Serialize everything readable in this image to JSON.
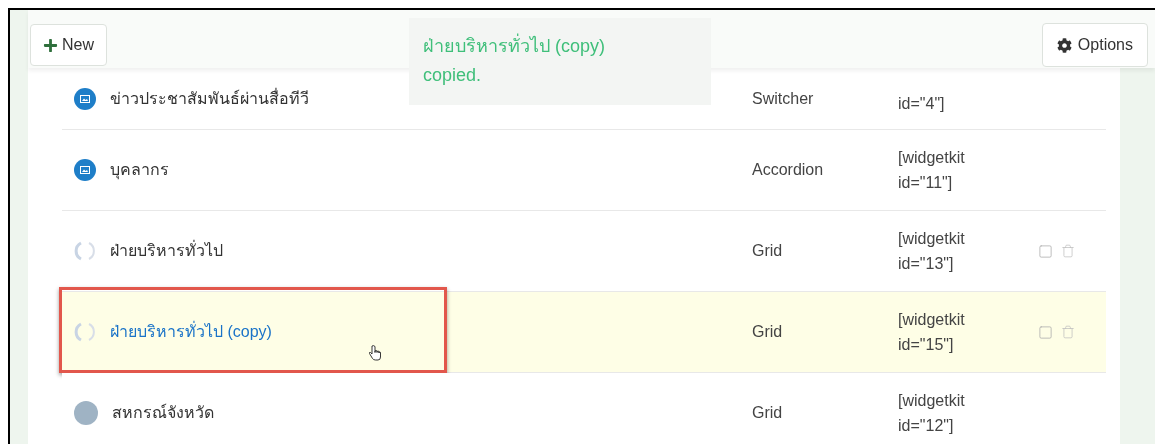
{
  "toolbar": {
    "new_button": "New",
    "options_button": "Options"
  },
  "toast": {
    "lines": [
      "ฝ่ายบริหารทั่วไป (copy)",
      "copied."
    ]
  },
  "rows": [
    {
      "name": "ข่าวประชาสัมพันธ์ผ่านสื่อทีวี",
      "kind": "image",
      "type": "Switcher",
      "shortcode": "id=\"4\"]",
      "clipped": true,
      "selected": false,
      "actions": false,
      "annotated": false
    },
    {
      "name": "บุคลากร",
      "kind": "image",
      "type": "Accordion",
      "shortcode": "[widgetkit id=\"11\"]",
      "clipped": false,
      "selected": false,
      "actions": false,
      "annotated": false
    },
    {
      "name": "ฝ่ายบริหารทั่วไป",
      "kind": "blank",
      "type": "Grid",
      "shortcode": "[widgetkit id=\"13\"]",
      "clipped": false,
      "selected": false,
      "actions": true,
      "annotated": false
    },
    {
      "name": "ฝ่ายบริหารทั่วไป (copy)",
      "kind": "blank",
      "type": "Grid",
      "shortcode": "[widgetkit id=\"15\"]",
      "clipped": false,
      "selected": true,
      "actions": true,
      "annotated": true
    },
    {
      "name": "สหกรณ์จังหวัด",
      "kind": "photo",
      "type": "Grid",
      "shortcode": "[widgetkit id=\"12\"]",
      "clipped": false,
      "selected": false,
      "actions": false,
      "annotated": false
    }
  ]
}
